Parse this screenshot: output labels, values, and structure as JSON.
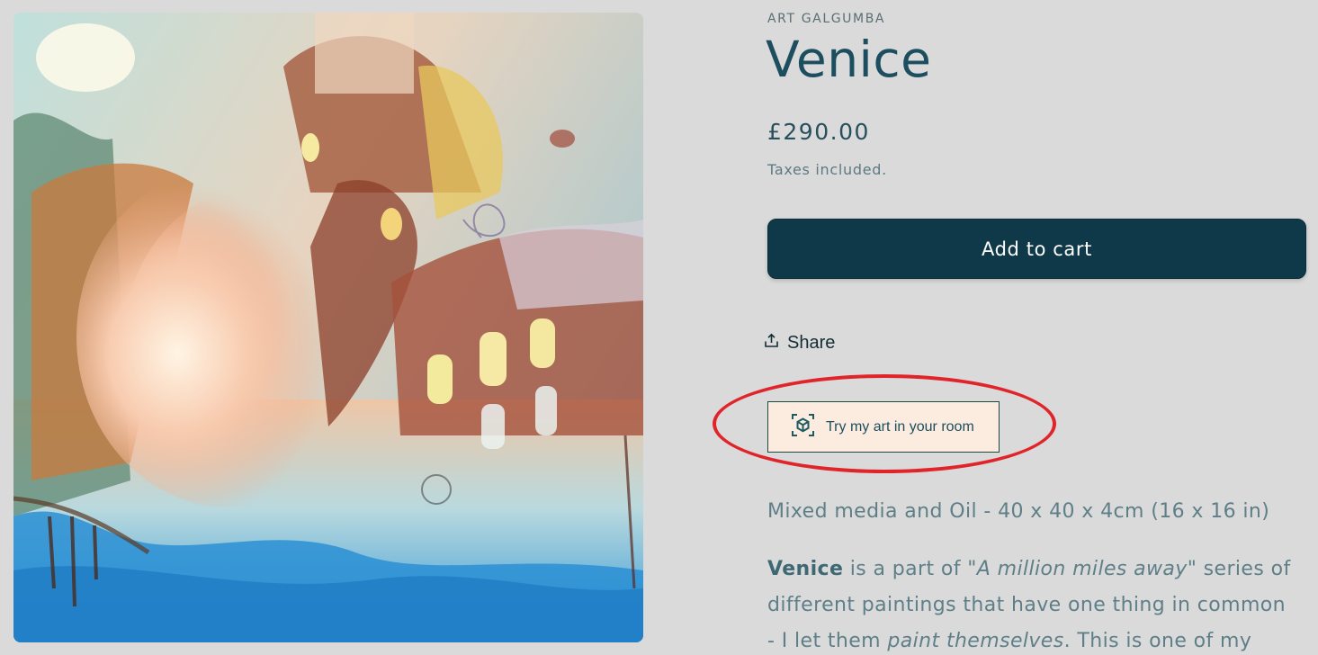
{
  "product": {
    "vendor": "ART GALGUMBA",
    "title": "Venice",
    "price": "£290.00",
    "tax_note": "Taxes included.",
    "image_alt": "Venice painting"
  },
  "actions": {
    "add_to_cart_label": "Add to cart",
    "share_label": "Share",
    "ar_button_label": "Try my art in your room"
  },
  "description": {
    "medium": "Mixed media and Oil - 40 x 40 x 4cm  (16 x 16 in)",
    "p1": {
      "bold": "Venice",
      "t1": " is a part of ",
      "italic1": "\"A million miles away\"",
      "t2": " series  of",
      "line2": "different paintings that have one thing in common",
      "t3": "- I let them ",
      "italic2": "paint themselves",
      "t4": ". This is one of my"
    }
  },
  "icons": {
    "share": "share-upload-icon",
    "ar": "ar-cube-icon"
  },
  "colors": {
    "page_bg": "#dadada",
    "primary_button": "#0f3949",
    "title": "#1d4e5f",
    "ar_button_bg": "#fcece0",
    "highlight": "#e0242a"
  }
}
